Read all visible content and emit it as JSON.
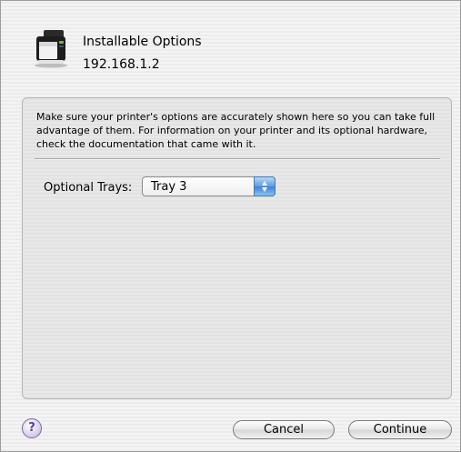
{
  "dialog": {
    "title": "Installable Options",
    "printer_address": "192.168.1.2",
    "printer_icon": "printer-icon"
  },
  "options": {
    "description": "Make sure your printer's options are accurately shown here so you can take full advantage of them.  For information on your printer and its optional hardware, check the documentation that came with it.",
    "optional_trays_label": "Optional Trays:",
    "optional_trays_value": "Tray 3"
  },
  "footer": {
    "help_label": "?",
    "cancel_label": "Cancel",
    "continue_label": "Continue"
  }
}
